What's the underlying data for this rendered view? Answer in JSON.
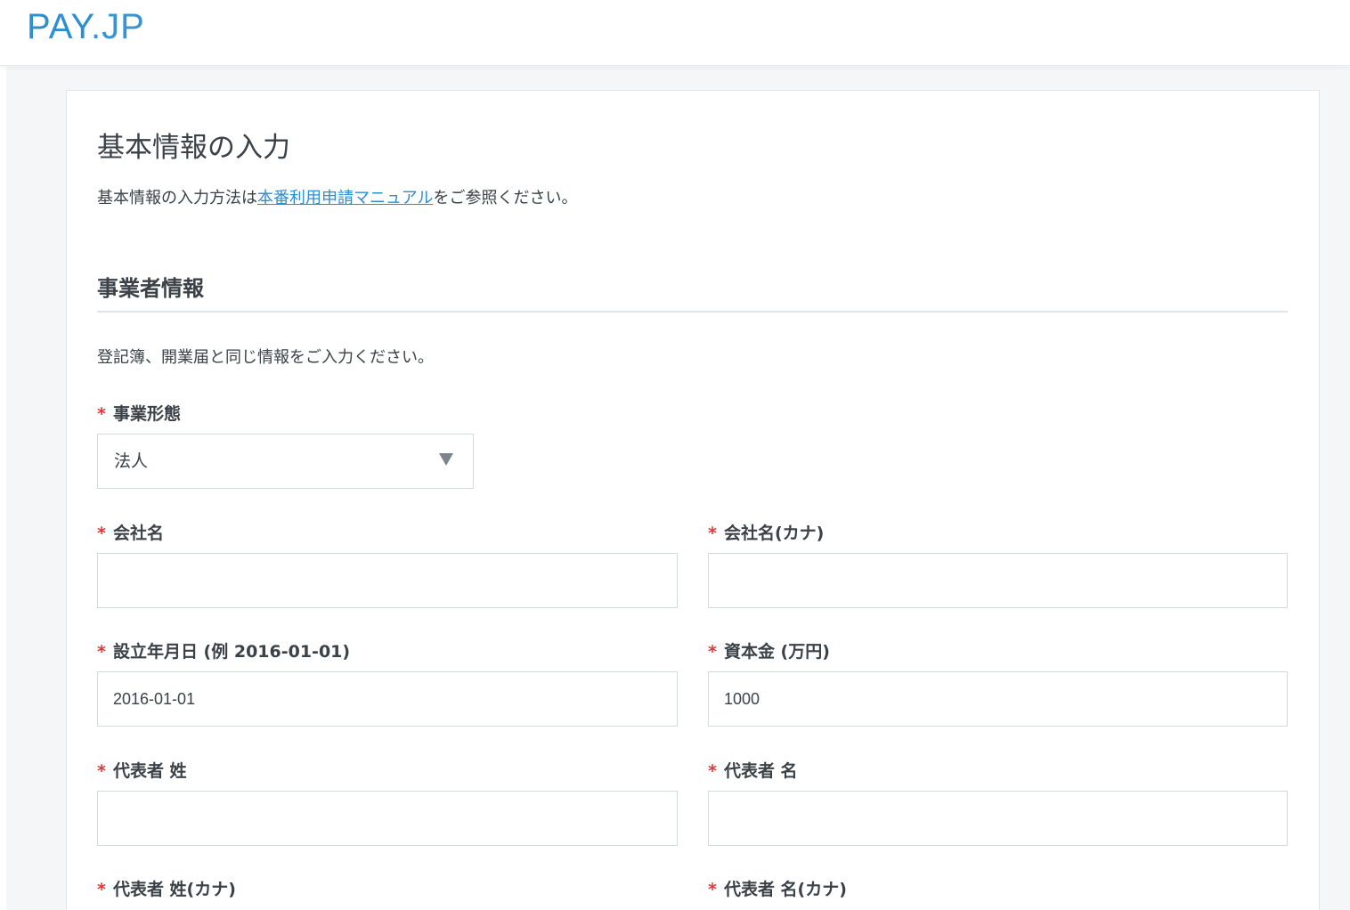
{
  "header": {
    "logo_strong": "PAY",
    "logo_light": ".JP"
  },
  "page": {
    "title": "基本情報の入力",
    "intro_prefix": "基本情報の入力方法は",
    "intro_link": "本番利用申請マニュアル",
    "intro_suffix": "をご参照ください。"
  },
  "section": {
    "title": "事業者情報",
    "description": "登記簿、開業届と同じ情報をご入力ください。"
  },
  "required_mark": "*",
  "fields": {
    "business_type": {
      "label": "事業形態",
      "value": "法人"
    },
    "company_name": {
      "label": "会社名",
      "value": ""
    },
    "company_name_kana": {
      "label": "会社名(カナ)",
      "value": ""
    },
    "founded_date": {
      "label": "設立年月日 (例 2016-01-01)",
      "value": "2016-01-01"
    },
    "capital": {
      "label": "資本金 (万円)",
      "value": "1000"
    },
    "rep_last_name": {
      "label": "代表者 姓",
      "value": ""
    },
    "rep_first_name": {
      "label": "代表者 名",
      "value": ""
    },
    "rep_last_name_kana": {
      "label": "代表者 姓(カナ)"
    },
    "rep_first_name_kana": {
      "label": "代表者 名(カナ)"
    }
  },
  "colors": {
    "brand": "#2e8fd0",
    "required": "#e03838",
    "text": "#3a4147",
    "background": "#f4f6f7"
  }
}
